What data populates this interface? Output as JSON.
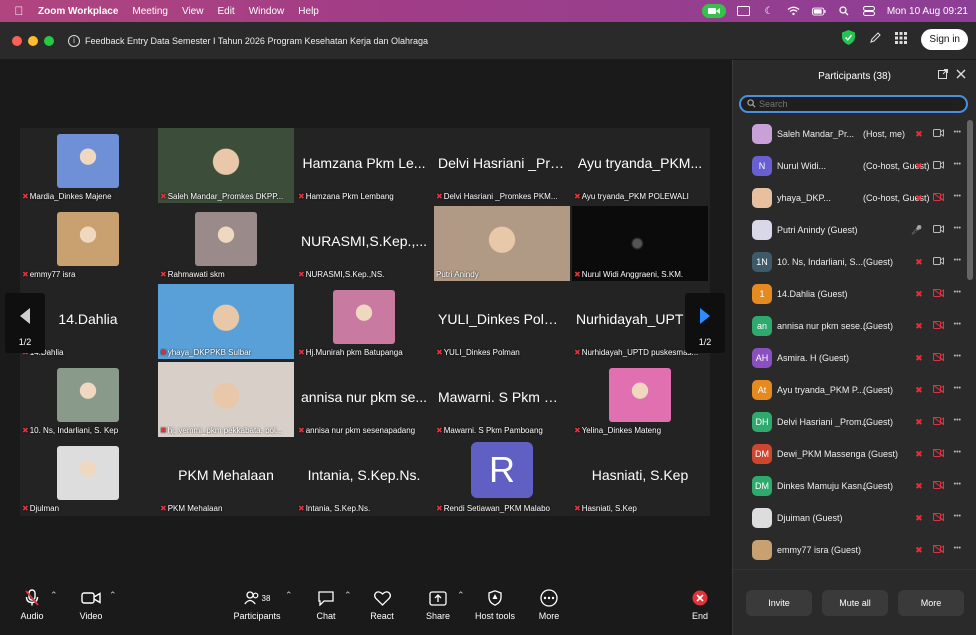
{
  "menubar": {
    "app_name": "Zoom Workplace",
    "items": [
      "Meeting",
      "View",
      "Edit",
      "Window",
      "Help"
    ],
    "datetime": "Mon 10 Aug  09:21"
  },
  "window": {
    "title": "Feedback Entry Data Semester I Tahun 2026 Program Kesehatan Kerja dan Olahraga",
    "signin_label": "Sign in"
  },
  "gallery": {
    "page_label_left": "1/2",
    "page_label_right": "1/2",
    "tiles": [
      {
        "caption": "Mardia_Dinkes Majene",
        "big": "",
        "kind": "photo",
        "color": "#6f8fd6"
      },
      {
        "caption": "Saleh Mandar_Promkes DKPP...",
        "big": "",
        "kind": "wide",
        "color": "#3c4d3a"
      },
      {
        "caption": "Hamzana Pkm Lembang",
        "big": "Hamzana Pkm Le...",
        "kind": "name"
      },
      {
        "caption": "Delvi Hasriani _Promkes PKM...",
        "big": "Delvi Hasriani _Pro...",
        "kind": "name"
      },
      {
        "caption": "Ayu tryanda_PKM POLEWALI",
        "big": "Ayu tryanda_PKM...",
        "kind": "name"
      },
      {
        "caption": "emmy77 isra",
        "big": "",
        "kind": "photo",
        "color": "#c9a070"
      },
      {
        "caption": "Rahmawati skm",
        "big": "",
        "kind": "photo",
        "color": "#9a8a8a"
      },
      {
        "caption": "NURASMI,S.Kep.,NS.",
        "big": "NURASMI,S.Kep.,...",
        "kind": "name"
      },
      {
        "caption": "Putri Anindy",
        "big": "",
        "kind": "wide",
        "color": "#b09a86",
        "active": true
      },
      {
        "caption": "Nurul Widi Anggraeni, S.KM.",
        "big": "",
        "kind": "dark"
      },
      {
        "caption": "14.Dahlia",
        "big": "14.Dahlia",
        "kind": "name"
      },
      {
        "caption": "yhaya_DKPPKB Sulbar",
        "big": "",
        "kind": "wide",
        "color": "#5aa0d8"
      },
      {
        "caption": "Hj.Munirah pkm Batupanga",
        "big": "",
        "kind": "photo",
        "color": "#c87aa0"
      },
      {
        "caption": "YULI_Dinkes Polman",
        "big": "YULI_Dinkes Polman",
        "kind": "name"
      },
      {
        "caption": "Nurhidayah_UPTD puskesmas...",
        "big": "Nurhidayah_UPTD...",
        "kind": "name"
      },
      {
        "caption": "10. Ns, Indarliani, S. Kep",
        "big": "",
        "kind": "photo",
        "color": "#8a9a8a"
      },
      {
        "caption": "hj. yemmi_pkm pekkabata, pol...",
        "big": "",
        "kind": "wide",
        "color": "#d8d0c8"
      },
      {
        "caption": "annisa nur pkm sesenapadang",
        "big": "annisa nur pkm se...",
        "kind": "name"
      },
      {
        "caption": "Mawarni. S Pkm Pamboang",
        "big": "Mawarni. S Pkm Pa...",
        "kind": "name"
      },
      {
        "caption": "Yelina_Dinkes Mateng",
        "big": "",
        "kind": "photo",
        "color": "#e070b0"
      },
      {
        "caption": "Djulman",
        "big": "",
        "kind": "photo",
        "color": "#dddddd"
      },
      {
        "caption": "PKM Mehalaan",
        "big": "PKM Mehalaan",
        "kind": "name"
      },
      {
        "caption": "Intania, S.Kep.Ns.",
        "big": "Intania, S.Kep.Ns.",
        "kind": "name"
      },
      {
        "caption": "Rendi Setiawan_PKM Malabo",
        "big": "R",
        "kind": "letter"
      },
      {
        "caption": "Hasniati, S.Kep",
        "big": "Hasniati, S.Kep",
        "kind": "name"
      }
    ]
  },
  "toolbar": {
    "audio": "Audio",
    "video": "Video",
    "participants": "Participants",
    "participants_count": "38",
    "chat": "Chat",
    "react": "React",
    "share": "Share",
    "host_tools": "Host tools",
    "more": "More",
    "end": "End"
  },
  "panel": {
    "title": "Participants (38)",
    "search_placeholder": "Search",
    "invite": "Invite",
    "mute_all": "Mute all",
    "more": "More",
    "participants": [
      {
        "name": "Saleh Mandar_Pr...",
        "role": "(Host, me)",
        "avatar": "",
        "color": "#c9a0d8",
        "mic_on": false,
        "cam_on": true
      },
      {
        "name": "Nurul Widi...",
        "role": "(Co-host, Guest)",
        "avatar": "N",
        "color": "#6a5fd0",
        "mic_on": false,
        "cam_on": true
      },
      {
        "name": "yhaya_DKP...",
        "role": "(Co-host, Guest)",
        "avatar": "",
        "color": "#e8c0a0",
        "mic_on": false,
        "cam_on": false
      },
      {
        "name": "Putri Anindy (Guest)",
        "role": "",
        "avatar": "",
        "color": "#d8d8e8",
        "mic_on": true,
        "cam_on": true
      },
      {
        "name": "10. Ns, Indarliani, S...",
        "role": "(Guest)",
        "avatar": "1N",
        "color": "#3e5a6a",
        "mic_on": false,
        "cam_on": true
      },
      {
        "name": "14.Dahlia (Guest)",
        "role": "",
        "avatar": "1",
        "color": "#e58a1f",
        "mic_on": false,
        "cam_on": false
      },
      {
        "name": "annisa nur pkm sese...",
        "role": "(Guest)",
        "avatar": "an",
        "color": "#2eaa6e",
        "mic_on": false,
        "cam_on": false
      },
      {
        "name": "Asmira. H (Guest)",
        "role": "",
        "avatar": "AH",
        "color": "#8a4fc0",
        "mic_on": false,
        "cam_on": false
      },
      {
        "name": "Ayu tryanda_PKM P...",
        "role": "(Guest)",
        "avatar": "At",
        "color": "#e58a1f",
        "mic_on": false,
        "cam_on": false
      },
      {
        "name": "Delvi Hasriani _Prom...",
        "role": "(Guest)",
        "avatar": "DH",
        "color": "#2eaa6e",
        "mic_on": false,
        "cam_on": false
      },
      {
        "name": "Dewi_PKM Massenga (Guest)",
        "role": "",
        "avatar": "DM",
        "color": "#d0452e",
        "mic_on": false,
        "cam_on": false
      },
      {
        "name": "Dinkes Mamuju Kasn...",
        "role": "(Guest)",
        "avatar": "DM",
        "color": "#2eaa6e",
        "mic_on": false,
        "cam_on": false
      },
      {
        "name": "Djuiman (Guest)",
        "role": "",
        "avatar": "",
        "color": "#dddddd",
        "mic_on": false,
        "cam_on": false
      },
      {
        "name": "emmy77 isra (Guest)",
        "role": "",
        "avatar": "",
        "color": "#c9a070",
        "mic_on": false,
        "cam_on": false
      }
    ]
  }
}
